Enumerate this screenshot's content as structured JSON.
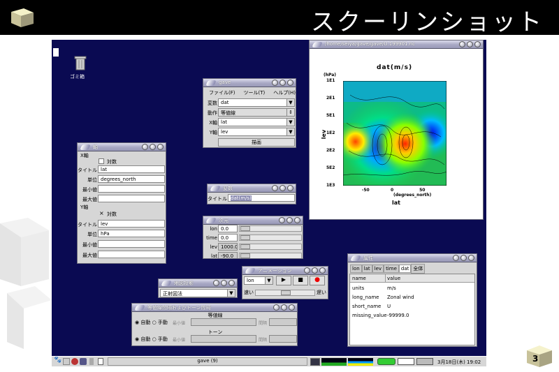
{
  "slide": {
    "title": "スクーリンショット",
    "page_number": "3"
  },
  "desktop": {
    "trash_label": "ゴミ箱"
  },
  "plot_window": {
    "title": "/home/seiya/gave/gave/U.199901.nc",
    "chart_title": "dat(m/s)",
    "y_unit": "(hPa)",
    "ylabel": "lev",
    "xlabel": "lat",
    "x_unit": "(degrees_north)",
    "y_ticks": [
      "1E1",
      "2E1",
      "5E1",
      "1E2",
      "2E2",
      "5E2",
      "1E3"
    ],
    "x_ticks": [
      "-50",
      "0",
      "50"
    ]
  },
  "gave_window": {
    "title": "gave",
    "menu": [
      "ファイル(F)",
      "ツール(T)",
      "ヘルプ(H)"
    ],
    "var_label": "変数",
    "var_value": "dat",
    "action_label": "動作",
    "action_value": "等値線",
    "x_label": "X軸",
    "x_value": "lat",
    "y_label": "Y軸",
    "y_value": "lev",
    "draw_button": "描画"
  },
  "axis_window": {
    "title": "軸",
    "x_section": "X軸",
    "x_log_label": "対数",
    "x_title_label": "タイトル",
    "x_title_value": "lat",
    "x_unit_label": "単位",
    "x_unit_value": "degrees_north",
    "x_min_label": "最小値",
    "x_max_label": "最大値",
    "y_section": "Y軸",
    "y_log_mark": "×",
    "y_log_label": "対数",
    "y_title_label": "タイトル",
    "y_title_value": "lev",
    "y_unit_label": "単位",
    "y_unit_value": "hPa",
    "y_min_label": "最小値",
    "y_max_label": "最大値"
  },
  "var_window": {
    "title": "変数",
    "title_label": "タイトル",
    "title_value": "dat(m/s)"
  },
  "dim_window": {
    "title": "次元",
    "rows": [
      {
        "name": "lon",
        "value": "0.0"
      },
      {
        "name": "time",
        "value": "0.0"
      },
      {
        "name": "lev",
        "value": "1000.0"
      },
      {
        "name": "lat",
        "value": "-90.0"
      }
    ]
  },
  "anim_window": {
    "title": "アニメーション",
    "dim_value": "lon",
    "fast_label": "速い",
    "slow_label": "遅い"
  },
  "proj_window": {
    "title": "地図投影",
    "value": "正射図法"
  },
  "contour_window": {
    "title": "等値線間隔およびトーン間隔",
    "contour_section": "等値線",
    "tone_section": "トーン",
    "auto_label": "自動",
    "manual_label": "手動",
    "min_label": "最小値",
    "interval_label": "間隔"
  },
  "attr_window": {
    "title": "属性",
    "tabs": [
      "lon",
      "lat",
      "lev",
      "time",
      "dat",
      "全体"
    ],
    "selected_tab": "dat",
    "headers": [
      "name",
      "value"
    ],
    "rows": [
      {
        "name": "units",
        "value": "m/s"
      },
      {
        "name": "long_name",
        "value": "Zonal wind"
      },
      {
        "name": "short_name",
        "value": "U"
      },
      {
        "name": "missing_value",
        "value": "-99999.0"
      }
    ]
  },
  "taskbar": {
    "task": "gave (9)",
    "clock": "3月18日(木) 19:02"
  }
}
